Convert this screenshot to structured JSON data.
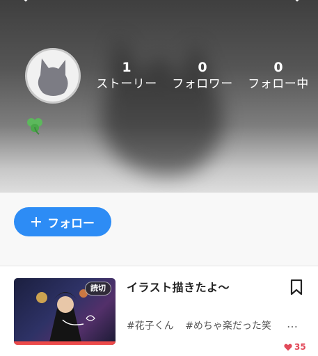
{
  "profile": {
    "stats": [
      {
        "count": "1",
        "label": "ストーリー"
      },
      {
        "count": "0",
        "label": "フォロワー"
      },
      {
        "count": "0",
        "label": "フォロー中"
      }
    ],
    "bio_emoji": "clover-icon"
  },
  "actions": {
    "follow_label": "フォロー"
  },
  "stories": [
    {
      "title": "イラスト描きたよ〜",
      "badge": "読切",
      "tags": [
        "#花子くん",
        "#めちゃ楽だった笑"
      ],
      "more": "…",
      "likes": "35"
    }
  ],
  "colors": {
    "accent": "#2d8cf5",
    "like": "#e24a5a",
    "thumb_bar": "#ec4a4a"
  },
  "icons": [
    "chevron-icon",
    "cat-avatar-icon",
    "clover-icon",
    "plus-icon",
    "bookmark-icon",
    "heart-icon"
  ]
}
